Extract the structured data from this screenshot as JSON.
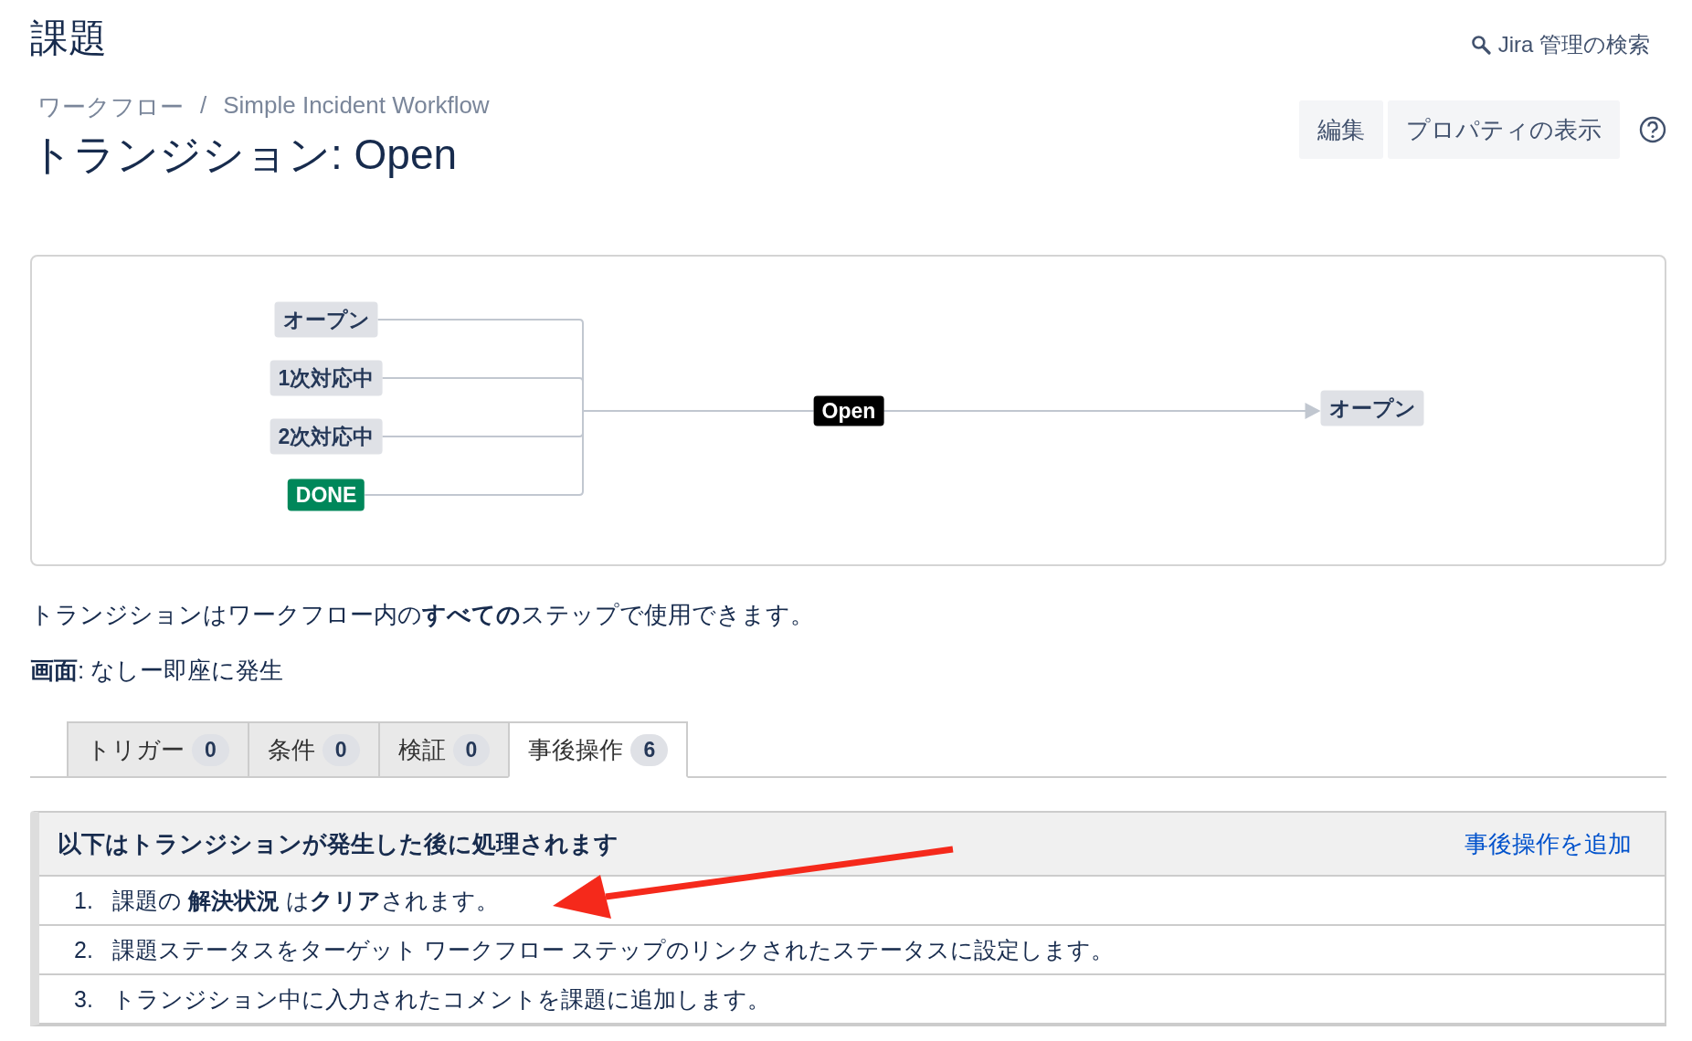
{
  "page_title": "課題",
  "admin_search": {
    "label": "Jira 管理の検索"
  },
  "breadcrumbs": [
    "ワークフロー",
    "Simple Incident Workflow"
  ],
  "breadcrumb_separator": "/",
  "heading": "トランジション: Open",
  "actions": [
    "編集",
    "プロパティの表示"
  ],
  "diagram": {
    "sources": [
      {
        "label": "オープン",
        "kind": "status"
      },
      {
        "label": "1次対応中",
        "kind": "status"
      },
      {
        "label": "2次対応中",
        "kind": "status"
      },
      {
        "label": "DONE",
        "kind": "done"
      }
    ],
    "transition": "Open",
    "target": {
      "label": "オープン",
      "kind": "status"
    }
  },
  "description": "トランジションはワークフロー内の**すべての**ステップで使用できます。",
  "screen": "**画面**: なしー即座に発生",
  "tabs": [
    {
      "label": "トリガー",
      "count": "0",
      "selected": false
    },
    {
      "label": "条件",
      "count": "0",
      "selected": false
    },
    {
      "label": "検証",
      "count": "0",
      "selected": false
    },
    {
      "label": "事後操作",
      "count": "6",
      "selected": true
    }
  ],
  "post_functions": {
    "title": "以下はトランジションが発生した後に処理されます",
    "add_link": "事後操作を追加",
    "items": [
      {
        "number": "1.",
        "text": "課題の **解決状況** は**クリア**されます。"
      },
      {
        "number": "2.",
        "text": "課題ステータスをターゲット ワークフロー ステップのリンクされたステータスに設定します。"
      },
      {
        "number": "3.",
        "text": "トランジション中に入力されたコメントを課題に追加します。"
      }
    ]
  }
}
